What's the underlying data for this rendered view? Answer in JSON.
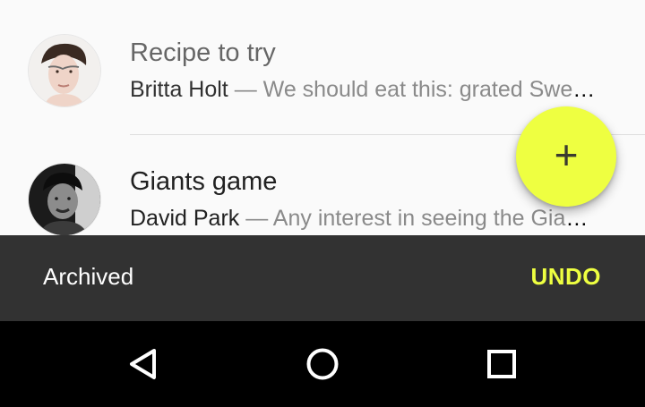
{
  "messages": [
    {
      "subject": "Recipe to try",
      "sender": "Britta Holt",
      "separator": "—",
      "snippet": "We should eat this: grated Swede, carrots, and parsnips..."
    },
    {
      "subject": "Giants game",
      "sender": "David Park",
      "separator": "—",
      "snippet": "Any interest in seeing the Giants game this weekend?"
    }
  ],
  "fab": {
    "icon": "plus-icon",
    "glyph": "+",
    "color": "#eeff41"
  },
  "snackbar": {
    "message": "Archived",
    "action_label": "UNDO",
    "action_color": "#eeff41",
    "background": "#323232"
  },
  "navigation": {
    "back_icon": "back-triangle-icon",
    "home_icon": "home-circle-icon",
    "recents_icon": "recents-square-icon"
  }
}
